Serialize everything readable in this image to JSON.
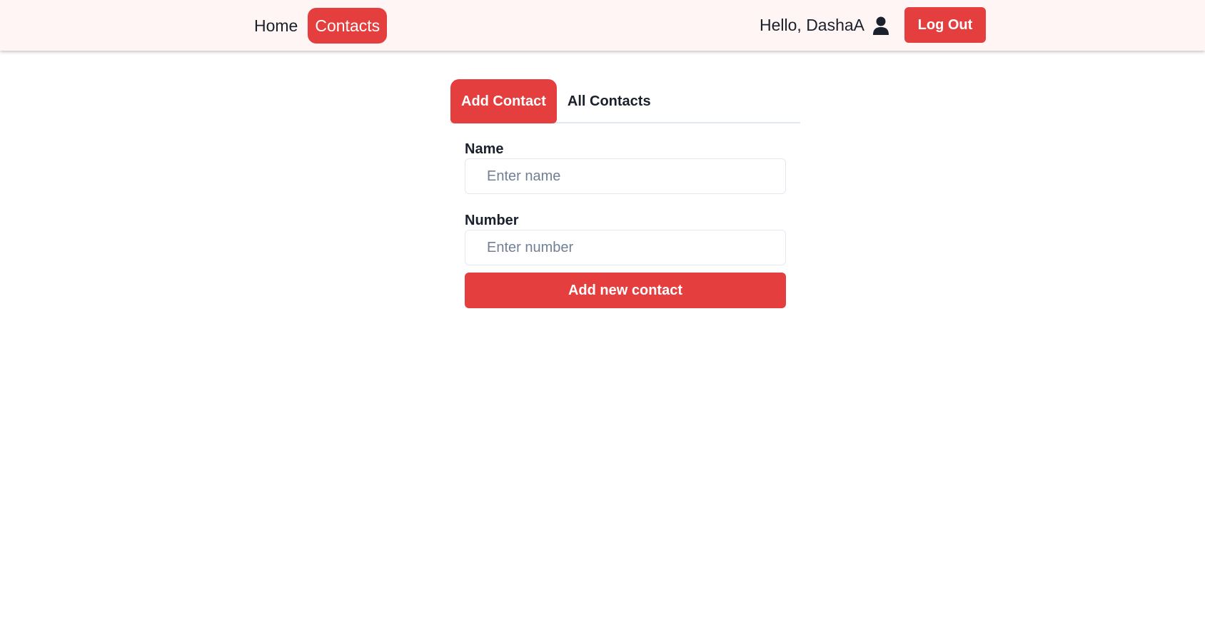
{
  "header": {
    "nav": [
      {
        "label": "Home",
        "active": false
      },
      {
        "label": "Contacts",
        "active": true
      }
    ],
    "greeting": "Hello, DashaA",
    "user_icon": "user-icon",
    "logout_label": "Log Out"
  },
  "tabs": [
    {
      "label": "Add Contact",
      "active": true
    },
    {
      "label": "All Contacts",
      "active": false
    }
  ],
  "form": {
    "name_label": "Name",
    "name_placeholder": "Enter name",
    "name_value": "",
    "number_label": "Number",
    "number_placeholder": "Enter number",
    "number_value": "",
    "submit_label": "Add new contact"
  },
  "colors": {
    "accent": "#e53e3e",
    "header_bg": "#fff5f5",
    "text": "#1a202c",
    "placeholder": "#718096"
  }
}
